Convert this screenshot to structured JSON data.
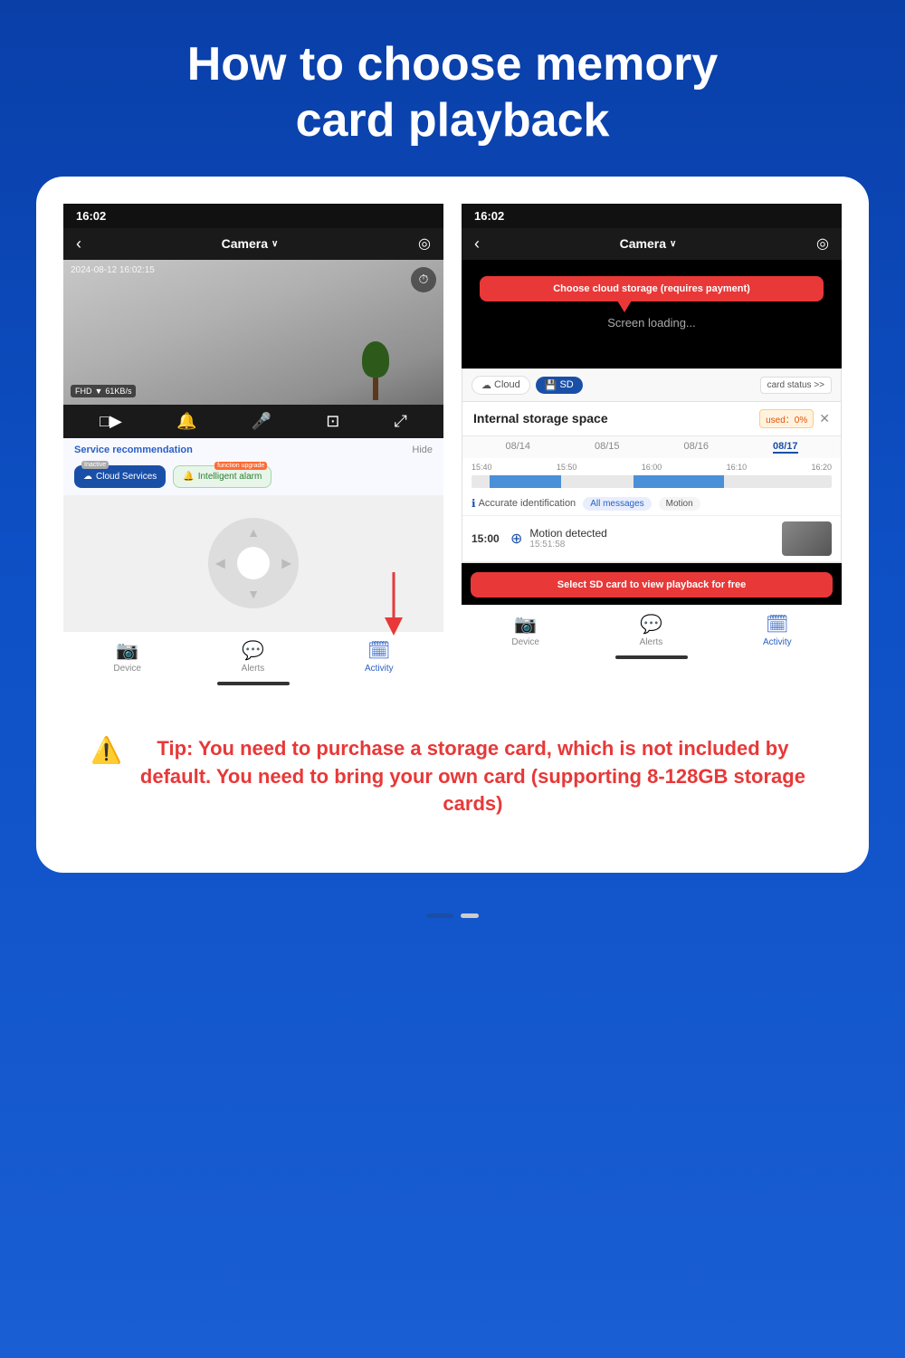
{
  "page": {
    "title_line1": "How to choose memory",
    "title_line2": "card playback"
  },
  "left_phone": {
    "time": "16:02",
    "camera_label": "Camera",
    "timestamp": "2024-08-12 16:02:15",
    "fhd": "FHD",
    "bitrate": "61KB/s",
    "service_rec": "Service recommendation",
    "hide": "Hide",
    "cloud_services": "Cloud Services",
    "inactive": "Inactive",
    "intelligent_alarm": "Intelligent alarm",
    "function_upgrade": "function upgrade",
    "bottom_nav": [
      {
        "label": "Device",
        "active": false
      },
      {
        "label": "Alerts",
        "active": false
      },
      {
        "label": "Activity",
        "active": true
      }
    ]
  },
  "right_phone": {
    "time": "16:02",
    "camera_label": "Camera",
    "loading": "Screen loading...",
    "cloud_tab": "Cloud",
    "sd_tab": "SD",
    "card_status": "card status >>",
    "storage_title": "Internal storage space",
    "used_label": "used：0%",
    "dates": [
      "08/14",
      "08/15",
      "08/16",
      "08/17"
    ],
    "timeline_times": [
      "15:40",
      "15:50",
      "16:00",
      "16:10",
      "16:20"
    ],
    "accurate_label": "Accurate identification",
    "all_messages": "All messages",
    "motion": "Motion",
    "event_time": "15:00",
    "event_title": "Motion detected",
    "event_sub": "15:51:58",
    "bottom_nav": [
      {
        "label": "Device",
        "active": false
      },
      {
        "label": "Alerts",
        "active": false
      },
      {
        "label": "Activity",
        "active": true
      }
    ],
    "cloud_tooltip": "Choose cloud storage (requires payment)",
    "sd_tooltip": "Select SD card to view playback for free"
  },
  "tip": {
    "text": "Tip: You need to purchase a storage card, which is not included by default. You need to bring your own card (supporting 8-128GB storage cards)"
  },
  "icons": {
    "back_arrow": "‹",
    "chevron": "∨",
    "settings": "◎",
    "playback_timer": "⏱",
    "video": "□▶",
    "speaker": "🔈",
    "mic": "🎤",
    "crop": "⊡",
    "fullscreen": "⤢",
    "cloud_icon": "☁",
    "sd_icon": "💾",
    "warning": "⚠️"
  }
}
